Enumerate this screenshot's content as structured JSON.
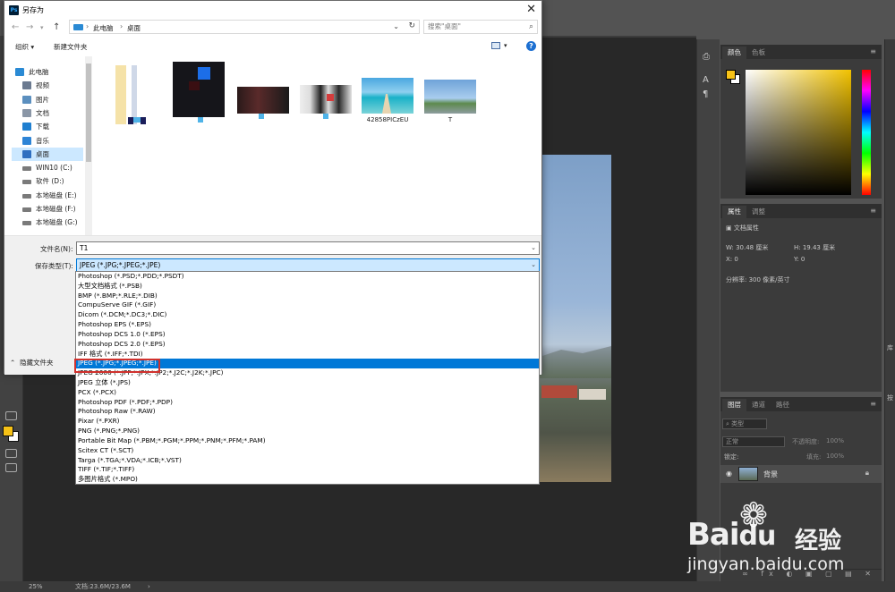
{
  "dialog": {
    "title": "另存为",
    "app_badge": "Ps",
    "address": {
      "segments": [
        "此电脑",
        "桌面"
      ]
    },
    "search_placeholder": "搜索\"桌面\"",
    "toolbar": {
      "organize": "组织 ▾",
      "new_folder": "新建文件夹"
    },
    "sidebar": [
      {
        "label": "此电脑",
        "icon": "computer-icon"
      },
      {
        "label": "视频",
        "icon": "video-folder-icon"
      },
      {
        "label": "图片",
        "icon": "pictures-folder-icon"
      },
      {
        "label": "文档",
        "icon": "documents-folder-icon"
      },
      {
        "label": "下载",
        "icon": "download-icon"
      },
      {
        "label": "音乐",
        "icon": "music-icon"
      },
      {
        "label": "桌面",
        "icon": "desktop-folder-icon",
        "selected": true
      },
      {
        "label": "WIN10 (C:)",
        "icon": "drive-icon"
      },
      {
        "label": "软件 (D:)",
        "icon": "drive-icon"
      },
      {
        "label": "本地磁盘 (E:)",
        "icon": "drive-icon"
      },
      {
        "label": "本地磁盘 (F:)",
        "icon": "drive-icon"
      },
      {
        "label": "本地磁盘 (G:)",
        "icon": "drive-icon"
      }
    ],
    "files": [
      {
        "name": ""
      },
      {
        "name": ""
      },
      {
        "name": ""
      },
      {
        "name": ""
      },
      {
        "name": "42858PICzEU"
      },
      {
        "name": "T"
      }
    ],
    "filename_label": "文件名(N):",
    "filename_value": "T1",
    "filetype_label": "保存类型(T):",
    "filetype_value": "JPEG (*.JPG;*.JPEG;*.JPE)",
    "hide_folders": "隐藏文件夹",
    "filetype_options": [
      "Photoshop (*.PSD;*.PDD;*.PSDT)",
      "大型文档格式 (*.PSB)",
      "BMP (*.BMP;*.RLE;*.DIB)",
      "CompuServe GIF (*.GIF)",
      "Dicom (*.DCM;*.DC3;*.DIC)",
      "Photoshop EPS (*.EPS)",
      "Photoshop DCS 1.0 (*.EPS)",
      "Photoshop DCS 2.0 (*.EPS)",
      "IFF 格式 (*.IFF;*.TDI)",
      "JPEG (*.JPG;*.JPEG;*.JPE)",
      "JPEG 2000 (*.JPF;*.JPX;*.JP2;*.J2C;*.J2K;*.JPC)",
      "JPEG 立体 (*.JPS)",
      "PCX (*.PCX)",
      "Photoshop PDF (*.PDF;*.PDP)",
      "Photoshop Raw (*.RAW)",
      "Pixar (*.PXR)",
      "PNG (*.PNG;*.PNG)",
      "Portable Bit Map (*.PBM;*.PGM;*.PPM;*.PNM;*.PFM;*.PAM)",
      "Scitex CT (*.SCT)",
      "Targa (*.TGA;*.VDA;*.ICB;*.VST)",
      "TIFF (*.TIF;*.TIFF)",
      "多图片格式 (*.MPO)"
    ],
    "selected_option_index": 9
  },
  "photoshop": {
    "panels": {
      "color_tabs": [
        "颜色",
        "色板"
      ],
      "props_tabs": [
        "属性",
        "调整"
      ],
      "layers_tabs": [
        "图层",
        "通道",
        "路径"
      ]
    },
    "properties": {
      "doc_title": "文档属性",
      "w": "W: 30.48 厘米",
      "h": "H: 19.43 厘米",
      "x": "X: 0",
      "y": "Y: 0",
      "resolution": "分辨率: 300 像素/英寸"
    },
    "layers": {
      "kind_filter": "类型",
      "blend_mode": "正常",
      "opacity_label": "不透明度:",
      "opacity_value": "100%",
      "lock_label": "锁定:",
      "fill_label": "填充:",
      "fill_value": "100%",
      "layer_name": "背景"
    },
    "status": {
      "zoom": "25%",
      "doc_info": "文档:23.6M/23.6M"
    },
    "right_edge_labels": [
      "库",
      "按"
    ],
    "colors": {
      "foreground": "#f7c216",
      "accent": "#0078d7",
      "highlight_box": "#d0312d"
    }
  },
  "watermark": {
    "brand": "Bai",
    "brand_suffix": "du",
    "cn": "经验",
    "url": "jingyan.baidu.com"
  }
}
